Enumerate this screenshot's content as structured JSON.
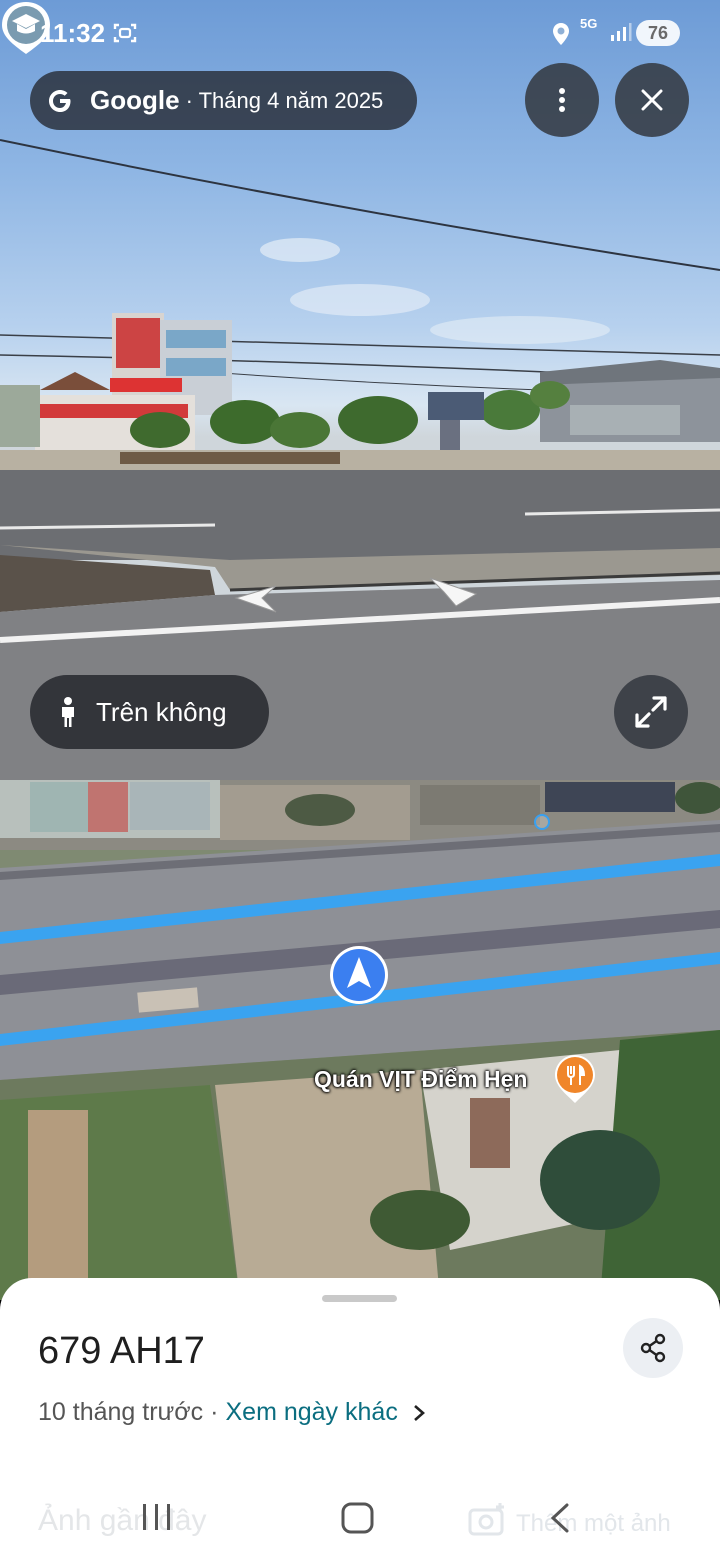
{
  "status_bar": {
    "time": "11:32",
    "network": "5G",
    "battery": "76",
    "icons": [
      "screenshot-icon",
      "location-icon",
      "signal-icon"
    ]
  },
  "street_view": {
    "provider": "Google",
    "date": "· Tháng 4 năm 2025",
    "mode_label": "Trên không",
    "icons": [
      "google-g-icon",
      "more-vert-icon",
      "close-icon",
      "person-icon",
      "expand-icon",
      "school-pin-icon"
    ]
  },
  "map": {
    "place_label": "Quán VỊT Điểm Hẹn",
    "icons": [
      "restaurant-icon",
      "navigation-arrow-icon"
    ]
  },
  "sheet": {
    "title": "679 AH17",
    "age": "10 tháng trước",
    "separator": "·",
    "link": "Xem ngày khác",
    "recent_label": "Ảnh gần đây",
    "add_photo_label": "Thêm một ảnh"
  },
  "colors": {
    "route_blue": "#3aa3f0",
    "marker_blue": "#3b7ff0",
    "food_orange": "#f0862a",
    "link_teal": "#0b6e80"
  }
}
